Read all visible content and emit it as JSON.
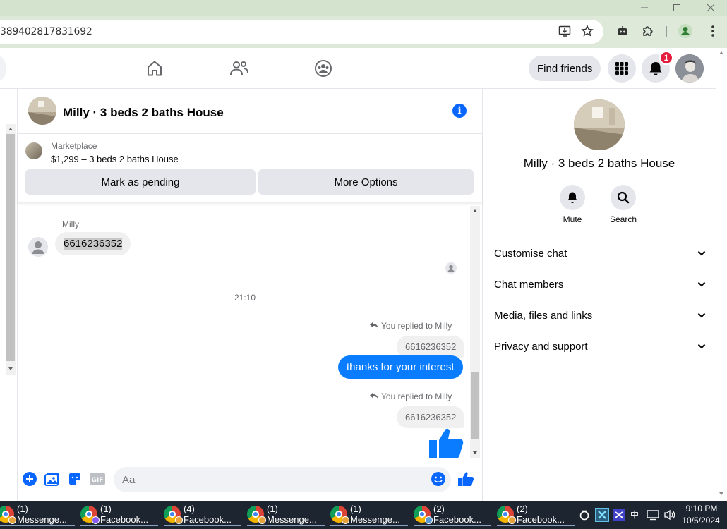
{
  "browser": {
    "url": "389402817831692"
  },
  "header": {
    "find_friends_label": "Find friends",
    "notification_count": "1"
  },
  "chat": {
    "title": "Milly · 3 beds 2 baths House",
    "marketplace": {
      "label": "Marketplace",
      "listing": "$1,299 – 3 beds 2 baths House",
      "mark_pending_label": "Mark as pending",
      "more_options_label": "More Options"
    },
    "messages": {
      "sender_name": "Milly",
      "incoming_text": "6616236352",
      "timestamp": "21:10",
      "reply_note_1": "You replied to Milly",
      "quote_1": "6616236352",
      "outgoing_1": "thanks for your interest",
      "reply_note_2": "You replied to Milly",
      "quote_2": "6616236352"
    },
    "composer": {
      "placeholder": "Aa"
    }
  },
  "right_panel": {
    "title": "Milly · 3 beds 2 baths House",
    "mute_label": "Mute",
    "search_label": "Search",
    "rows": [
      "Customise chat",
      "Chat members",
      "Media, files and links",
      "Privacy and support"
    ]
  },
  "taskbar": {
    "items": [
      "(1) Messenge...",
      "(1) Facebook...",
      "(4) Facebook...",
      "(1) Messenge...",
      "(1) Messenge...",
      "(2) Facebook...",
      "(2) Facebook..."
    ],
    "profile_colors": [
      "#e6a23c",
      "#8a5cf5",
      "#e6a23c",
      "#e6a23c",
      "#e6a23c",
      "#5a9bd5",
      "#e6a23c"
    ],
    "time": "9:10 PM",
    "date": "10/5/2024",
    "ime_label": "中"
  },
  "colors": {
    "accent": "#0866ff",
    "bubble_outgoing": "#0a7cff",
    "badge": "#e41e3f"
  }
}
